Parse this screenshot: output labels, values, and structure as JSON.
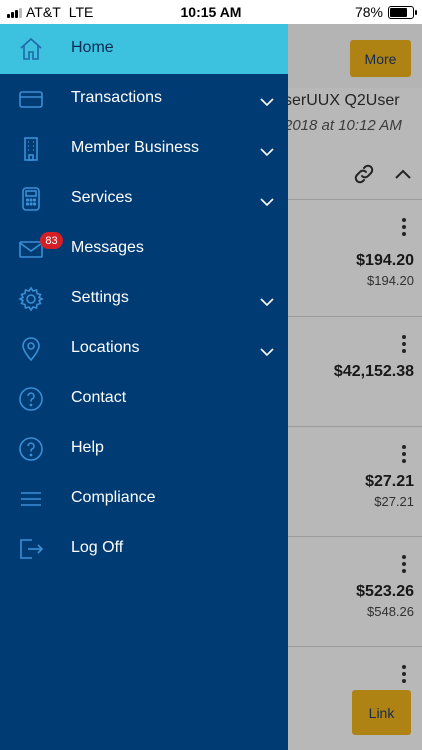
{
  "status_bar": {
    "carrier": "AT&T",
    "network": "LTE",
    "time": "10:15 AM",
    "battery_percent": "78%",
    "battery_level": 0.78
  },
  "background": {
    "more_label": "More",
    "user_name_fragment": "serUUX Q2User",
    "last_login_fragment": "2018 at 10:12 AM",
    "accounts": [
      {
        "amount": "$194.20",
        "sub_amount": "$194.20"
      },
      {
        "amount": "$42,152.38",
        "sub_amount": ""
      },
      {
        "amount": "$27.21",
        "sub_amount": "$27.21"
      },
      {
        "amount": "$523.26",
        "sub_amount": "$548.26"
      }
    ],
    "link_label": "Link"
  },
  "drawer": {
    "colors": {
      "background": "#003b73",
      "active": "#3cc1df",
      "badge": "#d51f26",
      "accent": "#f3b51c"
    },
    "items": [
      {
        "label": "Home",
        "icon": "home-icon",
        "active": true
      },
      {
        "label": "Transactions",
        "icon": "credit-card-icon",
        "has_submenu": true
      },
      {
        "label": "Member Business",
        "icon": "building-icon",
        "has_submenu": true
      },
      {
        "label": "Services",
        "icon": "calculator-icon",
        "has_submenu": true
      },
      {
        "label": "Messages",
        "icon": "envelope-icon",
        "badge": "83"
      },
      {
        "label": "Settings",
        "icon": "gear-icon",
        "has_submenu": true
      },
      {
        "label": "Locations",
        "icon": "map-pin-icon",
        "has_submenu": true
      },
      {
        "label": "Contact",
        "icon": "question-circle-icon"
      },
      {
        "label": "Help",
        "icon": "question-circle-icon"
      },
      {
        "label": "Compliance",
        "icon": "list-icon"
      },
      {
        "label": "Log Off",
        "icon": "log-off-icon"
      }
    ]
  }
}
